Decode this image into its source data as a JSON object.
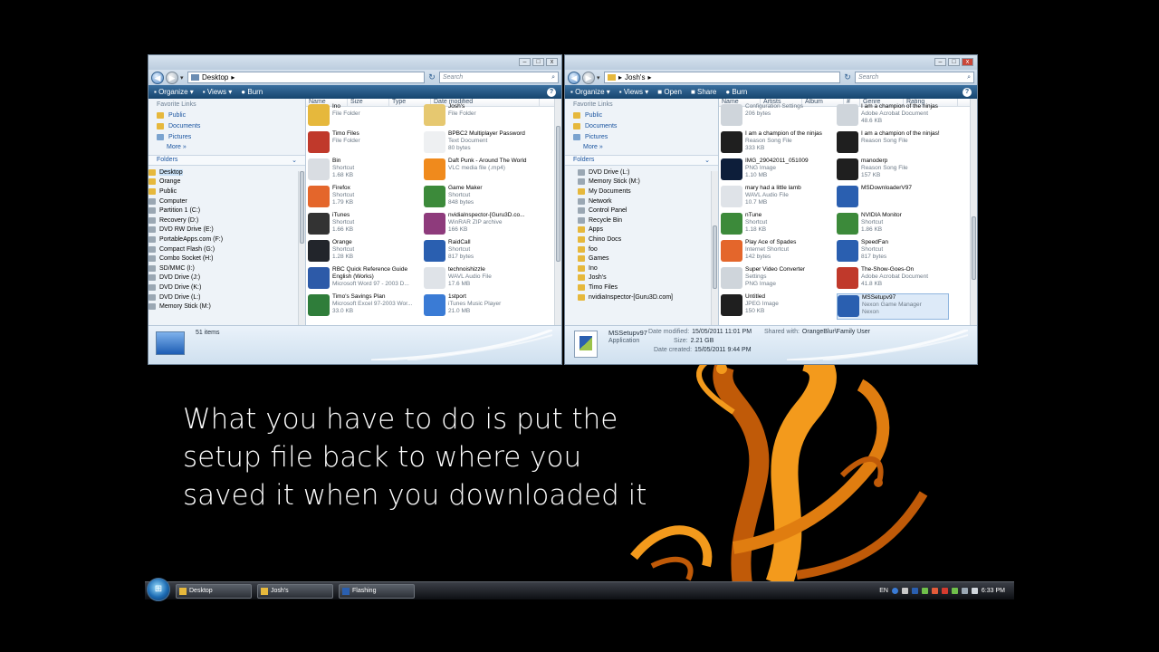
{
  "caption": {
    "line1": "What you have to do is put the",
    "line2": "setup file back to where you",
    "line3": "saved it when you downloaded it"
  },
  "left_window": {
    "path": "Desktop",
    "search_placeholder": "Search",
    "toolbar": {
      "organize": "Organize",
      "views": "Views",
      "burn": "Burn"
    },
    "favorite_links_label": "Favorite Links",
    "favorites": [
      "Public",
      "Documents",
      "Pictures"
    ],
    "more_label": "More",
    "folders_label": "Folders",
    "tree": [
      "Desktop",
      "Orange",
      "Public",
      "Computer",
      "Partition 1 (C:)",
      "Recovery (D:)",
      "DVD RW Drive (E:)",
      "PortableApps.com (F:)",
      "Compact Flash (G:)",
      "Combo Socket (H:)",
      "SD/MMC (I:)",
      "DVD Drive (J:)",
      "DVD Drive (K:)",
      "DVD Drive (L:)",
      "Memory Stick (M:)"
    ],
    "columns": [
      "Name",
      "Size",
      "Type",
      "Date modified"
    ],
    "items": [
      {
        "name": "Ino",
        "sub1": "File Folder",
        "sub2": "",
        "color": "#e6b83c"
      },
      {
        "name": "Josh's",
        "sub1": "File Folder",
        "sub2": "",
        "color": "#e6c870"
      },
      {
        "name": "Timo Files",
        "sub1": "File Folder",
        "sub2": "",
        "color": "#c0392b"
      },
      {
        "name": "BPBC2 Multiplayer Password",
        "sub1": "Text Document",
        "sub2": "80 bytes",
        "color": "#eef0f2"
      },
      {
        "name": "Bin",
        "sub1": "Shortcut",
        "sub2": "1.68 KB",
        "color": "#d9dde2"
      },
      {
        "name": "Daft Punk - Around The World",
        "sub1": "VLC media file (.mp4)",
        "sub2": "",
        "color": "#f08a1c"
      },
      {
        "name": "Firefox",
        "sub1": "Shortcut",
        "sub2": "1.79 KB",
        "color": "#e4662b"
      },
      {
        "name": "Game Maker",
        "sub1": "Shortcut",
        "sub2": "848 bytes",
        "color": "#3c8a3a"
      },
      {
        "name": "iTunes",
        "sub1": "Shortcut",
        "sub2": "1.66 KB",
        "color": "#333333"
      },
      {
        "name": "nvidiaInspector-[Guru3D.co...",
        "sub1": "WinRAR ZIP archive",
        "sub2": "166 KB",
        "color": "#8e3b7c"
      },
      {
        "name": "Orange",
        "sub1": "Shortcut",
        "sub2": "1.28 KB",
        "color": "#22252b"
      },
      {
        "name": "RaidCall",
        "sub1": "Shortcut",
        "sub2": "817 bytes",
        "color": "#2a5fb0"
      },
      {
        "name": "RBC Quick Reference Guide English (Works)",
        "sub1": "Microsoft Word 97 - 2003 D...",
        "sub2": "",
        "color": "#2d5aa8"
      },
      {
        "name": "technoishizzle",
        "sub1": "WAVL Audio File",
        "sub2": "17.6 MB",
        "color": "#dfe3e8"
      },
      {
        "name": "Timo's Savings Plan",
        "sub1": "Microsoft Excel 97-2003 Wor...",
        "sub2": "33.0 KB",
        "color": "#2f7d3a"
      },
      {
        "name": "1stport",
        "sub1": "iTunes Music Player",
        "sub2": "21.0 MB",
        "color": "#3a7bd5"
      }
    ],
    "status_count": "51 items"
  },
  "right_window": {
    "path": "Josh's",
    "search_placeholder": "Search",
    "toolbar": {
      "organize": "Organize",
      "views": "Views",
      "open": "Open",
      "share": "Share",
      "burn": "Burn"
    },
    "favorite_links_label": "Favorite Links",
    "favorites": [
      "Public",
      "Documents",
      "Pictures"
    ],
    "more_label": "More",
    "folders_label": "Folders",
    "tree": [
      "DVD Drive (L:)",
      "Memory Stick (M:)",
      "My Documents",
      "Network",
      "Control Panel",
      "Recycle Bin",
      "Apps",
      "Chino Docs",
      "foo",
      "Games",
      "Ino",
      "Josh's",
      "Timo Files",
      "nvidiaInspector-[Guru3D.com]"
    ],
    "columns": [
      "Name",
      "Artists",
      "Album",
      "#",
      "Genre",
      "Rating"
    ],
    "items": [
      {
        "name": "",
        "sub1": "Configuration Settings",
        "sub2": "206 bytes",
        "color": "#cfd5db"
      },
      {
        "name": "I am a champion of the ninjas",
        "sub1": "Adobe Acrobat Document",
        "sub2": "48.6 KB",
        "color": "#cfd5db"
      },
      {
        "name": "I am a champion of the ninjas",
        "sub1": "Reason Song File",
        "sub2": "333 KB",
        "color": "#1f1f1f"
      },
      {
        "name": "I am a champion of the ninjas!",
        "sub1": "Reason Song File",
        "sub2": "",
        "color": "#1f1f1f"
      },
      {
        "name": "IMG_29042011_051009",
        "sub1": "PNG Image",
        "sub2": "1.10 MB",
        "color": "#0d1e3a"
      },
      {
        "name": "manoderp",
        "sub1": "Reason Song File",
        "sub2": "157 KB",
        "color": "#1f1f1f"
      },
      {
        "name": "mary had a little lamb",
        "sub1": "WAVL Audio File",
        "sub2": "10.7 MB",
        "color": "#dfe3e8"
      },
      {
        "name": "MSDownloaderV97",
        "sub1": "",
        "sub2": "",
        "color": "#2a5fb0"
      },
      {
        "name": "nTune",
        "sub1": "Shortcut",
        "sub2": "1.18 KB",
        "color": "#3c8a3a"
      },
      {
        "name": "NVIDIA Monitor",
        "sub1": "Shortcut",
        "sub2": "1.86 KB",
        "color": "#3c8a3a"
      },
      {
        "name": "Play Ace of Spades",
        "sub1": "Internet Shortcut",
        "sub2": "142 bytes",
        "color": "#e4662b"
      },
      {
        "name": "SpeedFan",
        "sub1": "Shortcut",
        "sub2": "817 bytes",
        "color": "#2a5fb0"
      },
      {
        "name": "Super Video Converter",
        "sub1": "Settings",
        "sub2": "PNG Image",
        "color": "#cfd5db"
      },
      {
        "name": "The-Show-Goes-On",
        "sub1": "Adobe Acrobat Document",
        "sub2": "41.8 KB",
        "color": "#c0392b"
      },
      {
        "name": "Untitled",
        "sub1": "JPEG Image",
        "sub2": "150 KB",
        "color": "#1f1f1f"
      },
      {
        "name": "MSSetupv97",
        "sub1": "Nexon Game Manager",
        "sub2": "Nexon",
        "color": "#2a5fb0"
      }
    ],
    "details": {
      "name": "MSSetupv97",
      "type": "Application",
      "modified_label": "Date modified:",
      "modified": "15/05/2011 11:01 PM",
      "size_label": "Size:",
      "size": "2.21 GB",
      "created_label": "Date created:",
      "created": "15/05/2011 9:44 PM",
      "shared_label": "Shared with:",
      "shared": "OrangeBlur\\Family User"
    }
  },
  "taskbar": {
    "buttons": [
      "Desktop",
      "Josh's",
      "Flashing"
    ],
    "lang": "EN",
    "clock": "6:33 PM"
  },
  "colors": {
    "toolbar": "#1e4f7c",
    "deco_orange": "#f39a1c",
    "deco_dark": "#c05a08"
  }
}
